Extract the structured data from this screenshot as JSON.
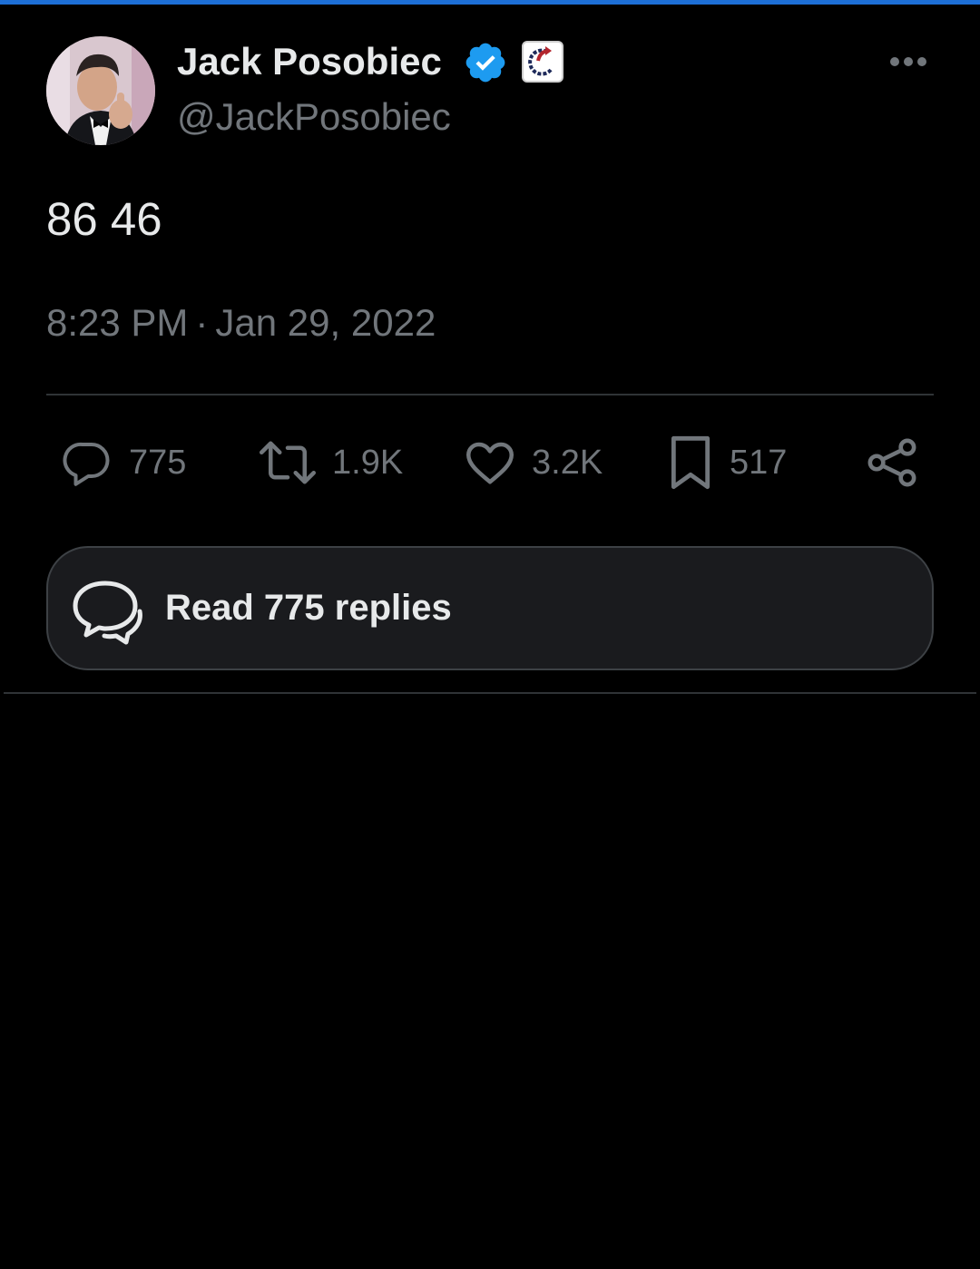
{
  "tweet": {
    "author": {
      "display_name": "Jack Posobiec",
      "handle": "@JackPosobiec",
      "verified": true,
      "verified_color": "#1d9bf0"
    },
    "text": "86 46",
    "time": "8:23 PM",
    "separator": "·",
    "date": "Jan 29, 2022"
  },
  "actions": {
    "replies": {
      "icon": "reply-icon",
      "count": "775"
    },
    "reposts": {
      "icon": "repost-icon",
      "count": "1.9K"
    },
    "likes": {
      "icon": "heart-icon",
      "count": "3.2K"
    },
    "bookmarks": {
      "icon": "bookmark-icon",
      "count": "517"
    },
    "share": {
      "icon": "share-icon"
    }
  },
  "replies_button": {
    "icon": "chat-bubbles-icon",
    "label": "Read 775 replies"
  },
  "colors": {
    "background": "#000000",
    "text_primary": "#e7e9ea",
    "text_secondary": "#71767b",
    "accent_top_bar": "#1d6fd6",
    "divider": "#2f3336",
    "replies_button_bg": "#1a1b1e"
  }
}
